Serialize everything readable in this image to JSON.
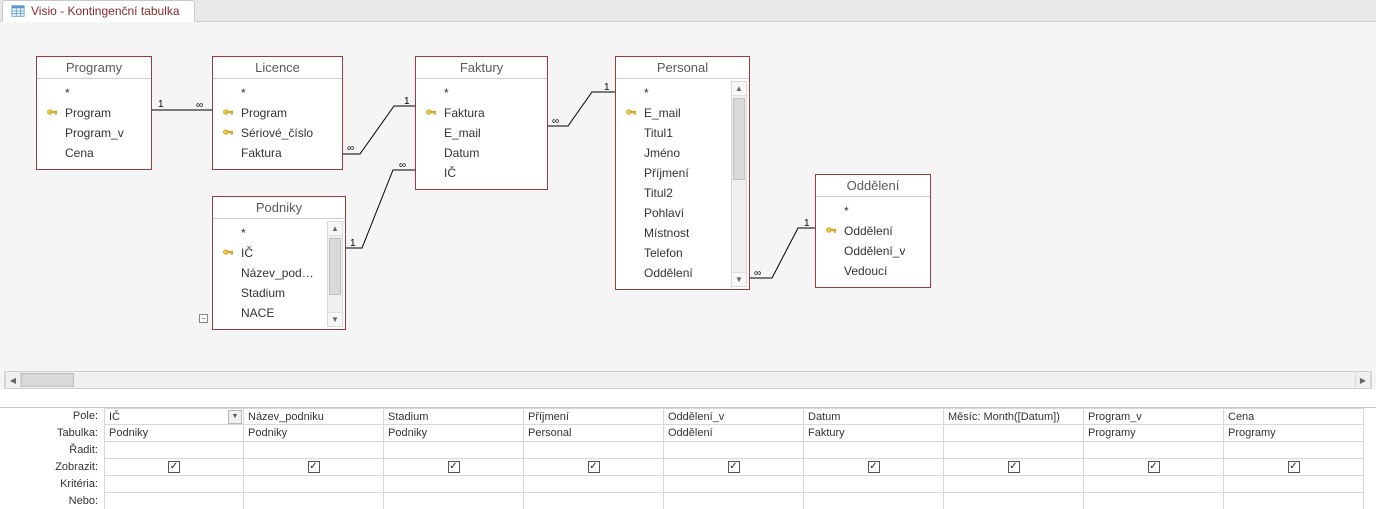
{
  "tab": {
    "title": "Visio - Kontingenční tabulka"
  },
  "tables": {
    "programy": {
      "title": "Programy",
      "fields": [
        {
          "name": "*",
          "key": false
        },
        {
          "name": "Program",
          "key": true
        },
        {
          "name": "Program_v",
          "key": false
        },
        {
          "name": "Cena",
          "key": false
        }
      ]
    },
    "licence": {
      "title": "Licence",
      "fields": [
        {
          "name": "*",
          "key": false
        },
        {
          "name": "Program",
          "key": true
        },
        {
          "name": "Sériové_číslo",
          "key": true
        },
        {
          "name": "Faktura",
          "key": false
        }
      ]
    },
    "faktury": {
      "title": "Faktury",
      "fields": [
        {
          "name": "*",
          "key": false
        },
        {
          "name": "Faktura",
          "key": true
        },
        {
          "name": "E_mail",
          "key": false
        },
        {
          "name": "Datum",
          "key": false
        },
        {
          "name": "IČ",
          "key": false
        }
      ]
    },
    "personal": {
      "title": "Personal",
      "fields": [
        {
          "name": "*",
          "key": false
        },
        {
          "name": "E_mail",
          "key": true
        },
        {
          "name": "Titul1",
          "key": false
        },
        {
          "name": "Jméno",
          "key": false
        },
        {
          "name": "Příjmení",
          "key": false
        },
        {
          "name": "Titul2",
          "key": false
        },
        {
          "name": "Pohlaví",
          "key": false
        },
        {
          "name": "Místnost",
          "key": false
        },
        {
          "name": "Telefon",
          "key": false
        },
        {
          "name": "Oddělení",
          "key": false
        }
      ]
    },
    "oddeleni": {
      "title": "Oddělení",
      "fields": [
        {
          "name": "*",
          "key": false
        },
        {
          "name": "Oddělení",
          "key": true
        },
        {
          "name": "Oddělení_v",
          "key": false
        },
        {
          "name": "Vedoucí",
          "key": false
        }
      ]
    },
    "podniky": {
      "title": "Podniky",
      "fields": [
        {
          "name": "*",
          "key": false
        },
        {
          "name": "IČ",
          "key": true
        },
        {
          "name": "Název_podniku",
          "key": false
        },
        {
          "name": "Stadium",
          "key": false
        },
        {
          "name": "NACE",
          "key": false
        }
      ]
    }
  },
  "relations": {
    "programy_licence": {
      "left": "1",
      "right": "∞"
    },
    "licence_faktury": {
      "left": "∞",
      "right": "1"
    },
    "faktury_personal": {
      "left": "∞",
      "right": "1"
    },
    "podniky_faktury": {
      "left": "1",
      "right": "∞"
    },
    "personal_oddeleni": {
      "left": "∞",
      "right": "1"
    }
  },
  "grid": {
    "labels": {
      "pole": "Pole:",
      "tabulka": "Tabulka:",
      "radit": "Řadit:",
      "zobrazit": "Zobrazit:",
      "kriteria": "Kritéria:",
      "nebo": "Nebo:"
    },
    "columns": [
      {
        "pole": "IČ",
        "tabulka": "Podniky",
        "zobrazit": true,
        "dropdown": true
      },
      {
        "pole": "Název_podniku",
        "tabulka": "Podniky",
        "zobrazit": true
      },
      {
        "pole": "Stadium",
        "tabulka": "Podniky",
        "zobrazit": true
      },
      {
        "pole": "Příjmení",
        "tabulka": "Personal",
        "zobrazit": true
      },
      {
        "pole": "Oddělení_v",
        "tabulka": "Oddělení",
        "zobrazit": true
      },
      {
        "pole": "Datum",
        "tabulka": "Faktury",
        "zobrazit": true
      },
      {
        "pole": "Měsíc: Month([Datum])",
        "tabulka": "",
        "zobrazit": true
      },
      {
        "pole": "Program_v",
        "tabulka": "Programy",
        "zobrazit": true
      },
      {
        "pole": "Cena",
        "tabulka": "Programy",
        "zobrazit": true
      }
    ]
  }
}
